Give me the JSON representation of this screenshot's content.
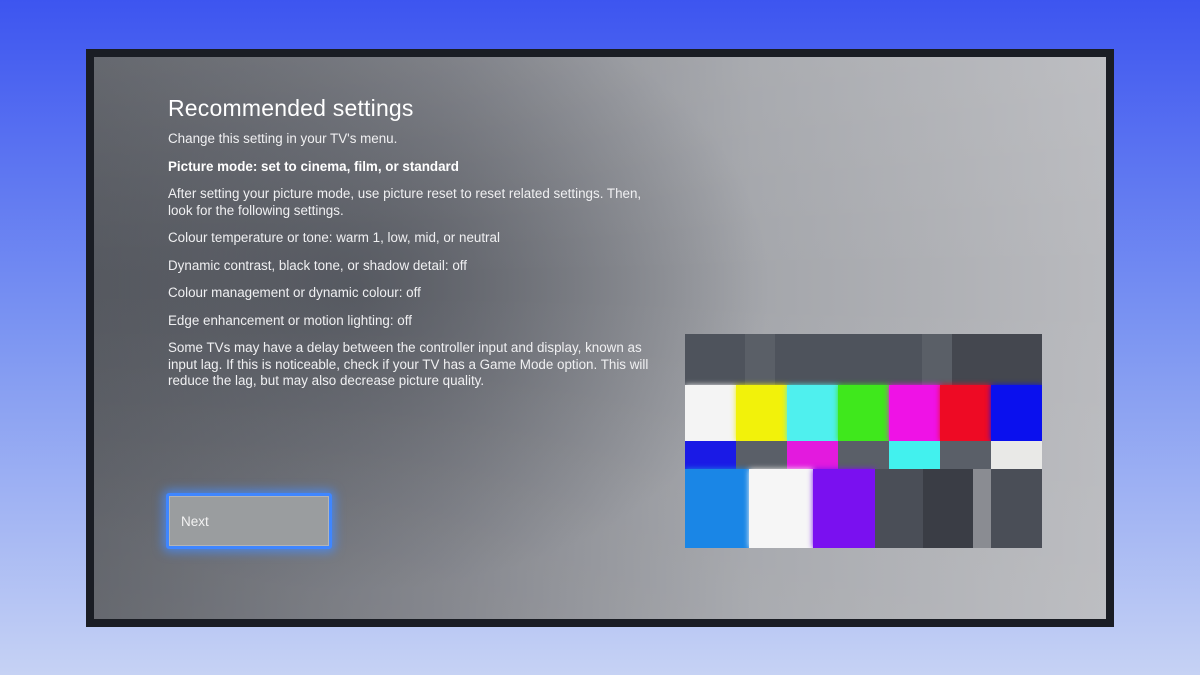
{
  "settings_screen": {
    "title": "Recommended settings",
    "paragraphs": [
      {
        "text": "Change this setting in your TV's menu.",
        "bold": false
      },
      {
        "text": "Picture mode: set to cinema, film, or standard",
        "bold": true
      },
      {
        "text": "After setting your picture mode, use picture reset to reset related settings. Then, look for the following settings.",
        "bold": false
      },
      {
        "text": "Colour temperature or tone: warm 1, low, mid, or neutral",
        "bold": false
      },
      {
        "text": "Dynamic contrast, black tone, or shadow detail: off",
        "bold": false
      },
      {
        "text": "Colour management or dynamic colour: off",
        "bold": false
      },
      {
        "text": "Edge enhancement or motion lighting: off",
        "bold": false
      },
      {
        "text": "Some TVs may have a delay between the controller input and display, known as input lag. If this is noticeable, check if your TV has a Game Mode option. This will reduce the lag, but may also decrease picture quality.",
        "bold": false
      }
    ],
    "next_label": "Next"
  },
  "test_pattern": {
    "top_row": [
      "#4e535c",
      "#5a5f67",
      "#4e535c",
      "#5a5f67",
      "#44474f"
    ],
    "color_bars": [
      "#f4f4f4",
      "#f2f20a",
      "#4ff0ee",
      "#3fe81c",
      "#ef12e6",
      "#ee0a24",
      "#0a10ee"
    ],
    "small_row": [
      "#1a1ae6",
      "#5a5f68",
      "#e31ade",
      "#5a5f68",
      "#42f1ee",
      "#5a5f68",
      "#e9e9e7"
    ],
    "bottom_row": [
      "#1a86e6",
      "#f6f6f6",
      "#7a10f0",
      "#4a4e57",
      "#3a3d45",
      "#8a8c92",
      "#4a4e57"
    ]
  }
}
